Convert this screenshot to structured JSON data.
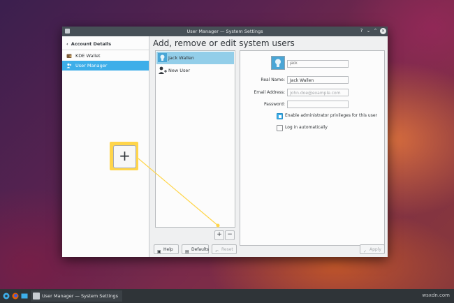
{
  "window": {
    "title": "User Manager — System Settings",
    "controls": {
      "help": "?",
      "minimize": "⌄",
      "maximize": "⌃",
      "close": "✕"
    }
  },
  "sidebar": {
    "back_label": "Account Details",
    "items": [
      {
        "label": "KDE Wallet",
        "selected": false
      },
      {
        "label": "User Manager",
        "selected": true
      }
    ]
  },
  "main": {
    "title": "Add, remove or edit system users"
  },
  "user_list": {
    "items": [
      {
        "label": "Jack Wallen",
        "selected": true
      },
      {
        "label": "New User",
        "selected": false
      }
    ],
    "add_label": "+",
    "remove_label": "−"
  },
  "details": {
    "username_placeholder": "jack",
    "real_name_label": "Real Name:",
    "real_name_value": "Jack Wallen",
    "email_label": "Email Address:",
    "email_placeholder": "john.doe@example.com",
    "password_label": "Password:",
    "password_value": "",
    "admin_label": "Enable administrator privileges for this user",
    "admin_checked": true,
    "autologin_label": "Log in automatically",
    "autologin_checked": false
  },
  "buttons": {
    "help": "Help",
    "defaults": "Defaults",
    "reset": "Reset",
    "apply": "Apply"
  },
  "callout": {
    "label": "+",
    "color": "#ffd54a"
  },
  "taskbar": {
    "task_label": "User Manager — System Settings"
  },
  "watermark": "wsxdn.com",
  "colors": {
    "accent": "#3daee9",
    "selection_light": "#93cee9",
    "titlebar": "#475057"
  }
}
